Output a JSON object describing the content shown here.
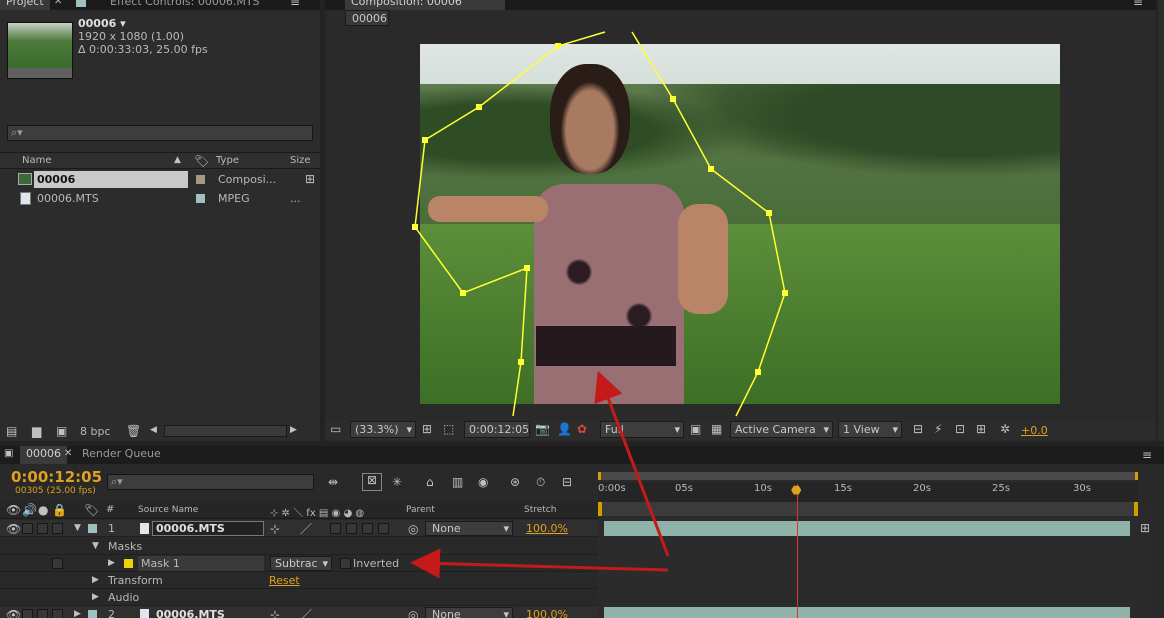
{
  "project_panel": {
    "tabs": [
      "Project",
      "Effect Controls: 00006.MTS"
    ],
    "selected_item": {
      "name": "00006 ▾",
      "resolution": "1920 x 1080 (1.00)",
      "duration": "Δ 0:00:33:03, 25.00 fps"
    },
    "search_placeholder": "⌕▾",
    "columns": {
      "name": "Name",
      "type": "Type",
      "size": "Size"
    },
    "items": [
      {
        "name": "00006",
        "type": "Composi...",
        "size": "",
        "label_color": "#a59a7e"
      },
      {
        "name": "00006.MTS",
        "type": "MPEG",
        "size": "...",
        "label_color": "#9fc0c0"
      }
    ],
    "footer": {
      "bpc": "8 bpc"
    }
  },
  "composition_panel": {
    "tab_title": "Composition: 00006",
    "breadcrumb": "00006",
    "toolbar": {
      "zoom": "(33.3%)",
      "timecode": "0:00:12:05",
      "resolution": "Full",
      "camera": "Active Camera",
      "view": "1 View",
      "exposure": "+0.0"
    }
  },
  "timeline_panel": {
    "tabs": [
      "00006",
      "Render Queue"
    ],
    "current_time": "0:00:12:05",
    "frame_info": "00305 (25.00 fps)",
    "search_placeholder": "⌕▾",
    "column_headers": {
      "source": "Source Name",
      "parent": "Parent",
      "stretch": "Stretch"
    },
    "ruler_labels": [
      "0:00s",
      "05s",
      "10s",
      "15s",
      "20s",
      "25s",
      "30s"
    ],
    "layers": [
      {
        "num": "1",
        "name": "00006.MTS",
        "parent": "None",
        "stretch": "100.0%"
      },
      {
        "num": "2",
        "name": "00006.MTS",
        "parent": "None",
        "stretch": "100.0%"
      }
    ],
    "masks_group": "Masks",
    "mask": {
      "name": "Mask 1",
      "mode": "Subtract",
      "inverted_label": "Inverted",
      "color": "#f0d000"
    },
    "transform": {
      "label": "Transform",
      "reset": "Reset"
    },
    "audio": "Audio",
    "playhead_fraction": 0.369
  },
  "colors": {
    "accent": "#e0a020",
    "mask": "#ffff33",
    "arrow": "#c41a1a",
    "layer_bar": "#8fb2aa"
  }
}
